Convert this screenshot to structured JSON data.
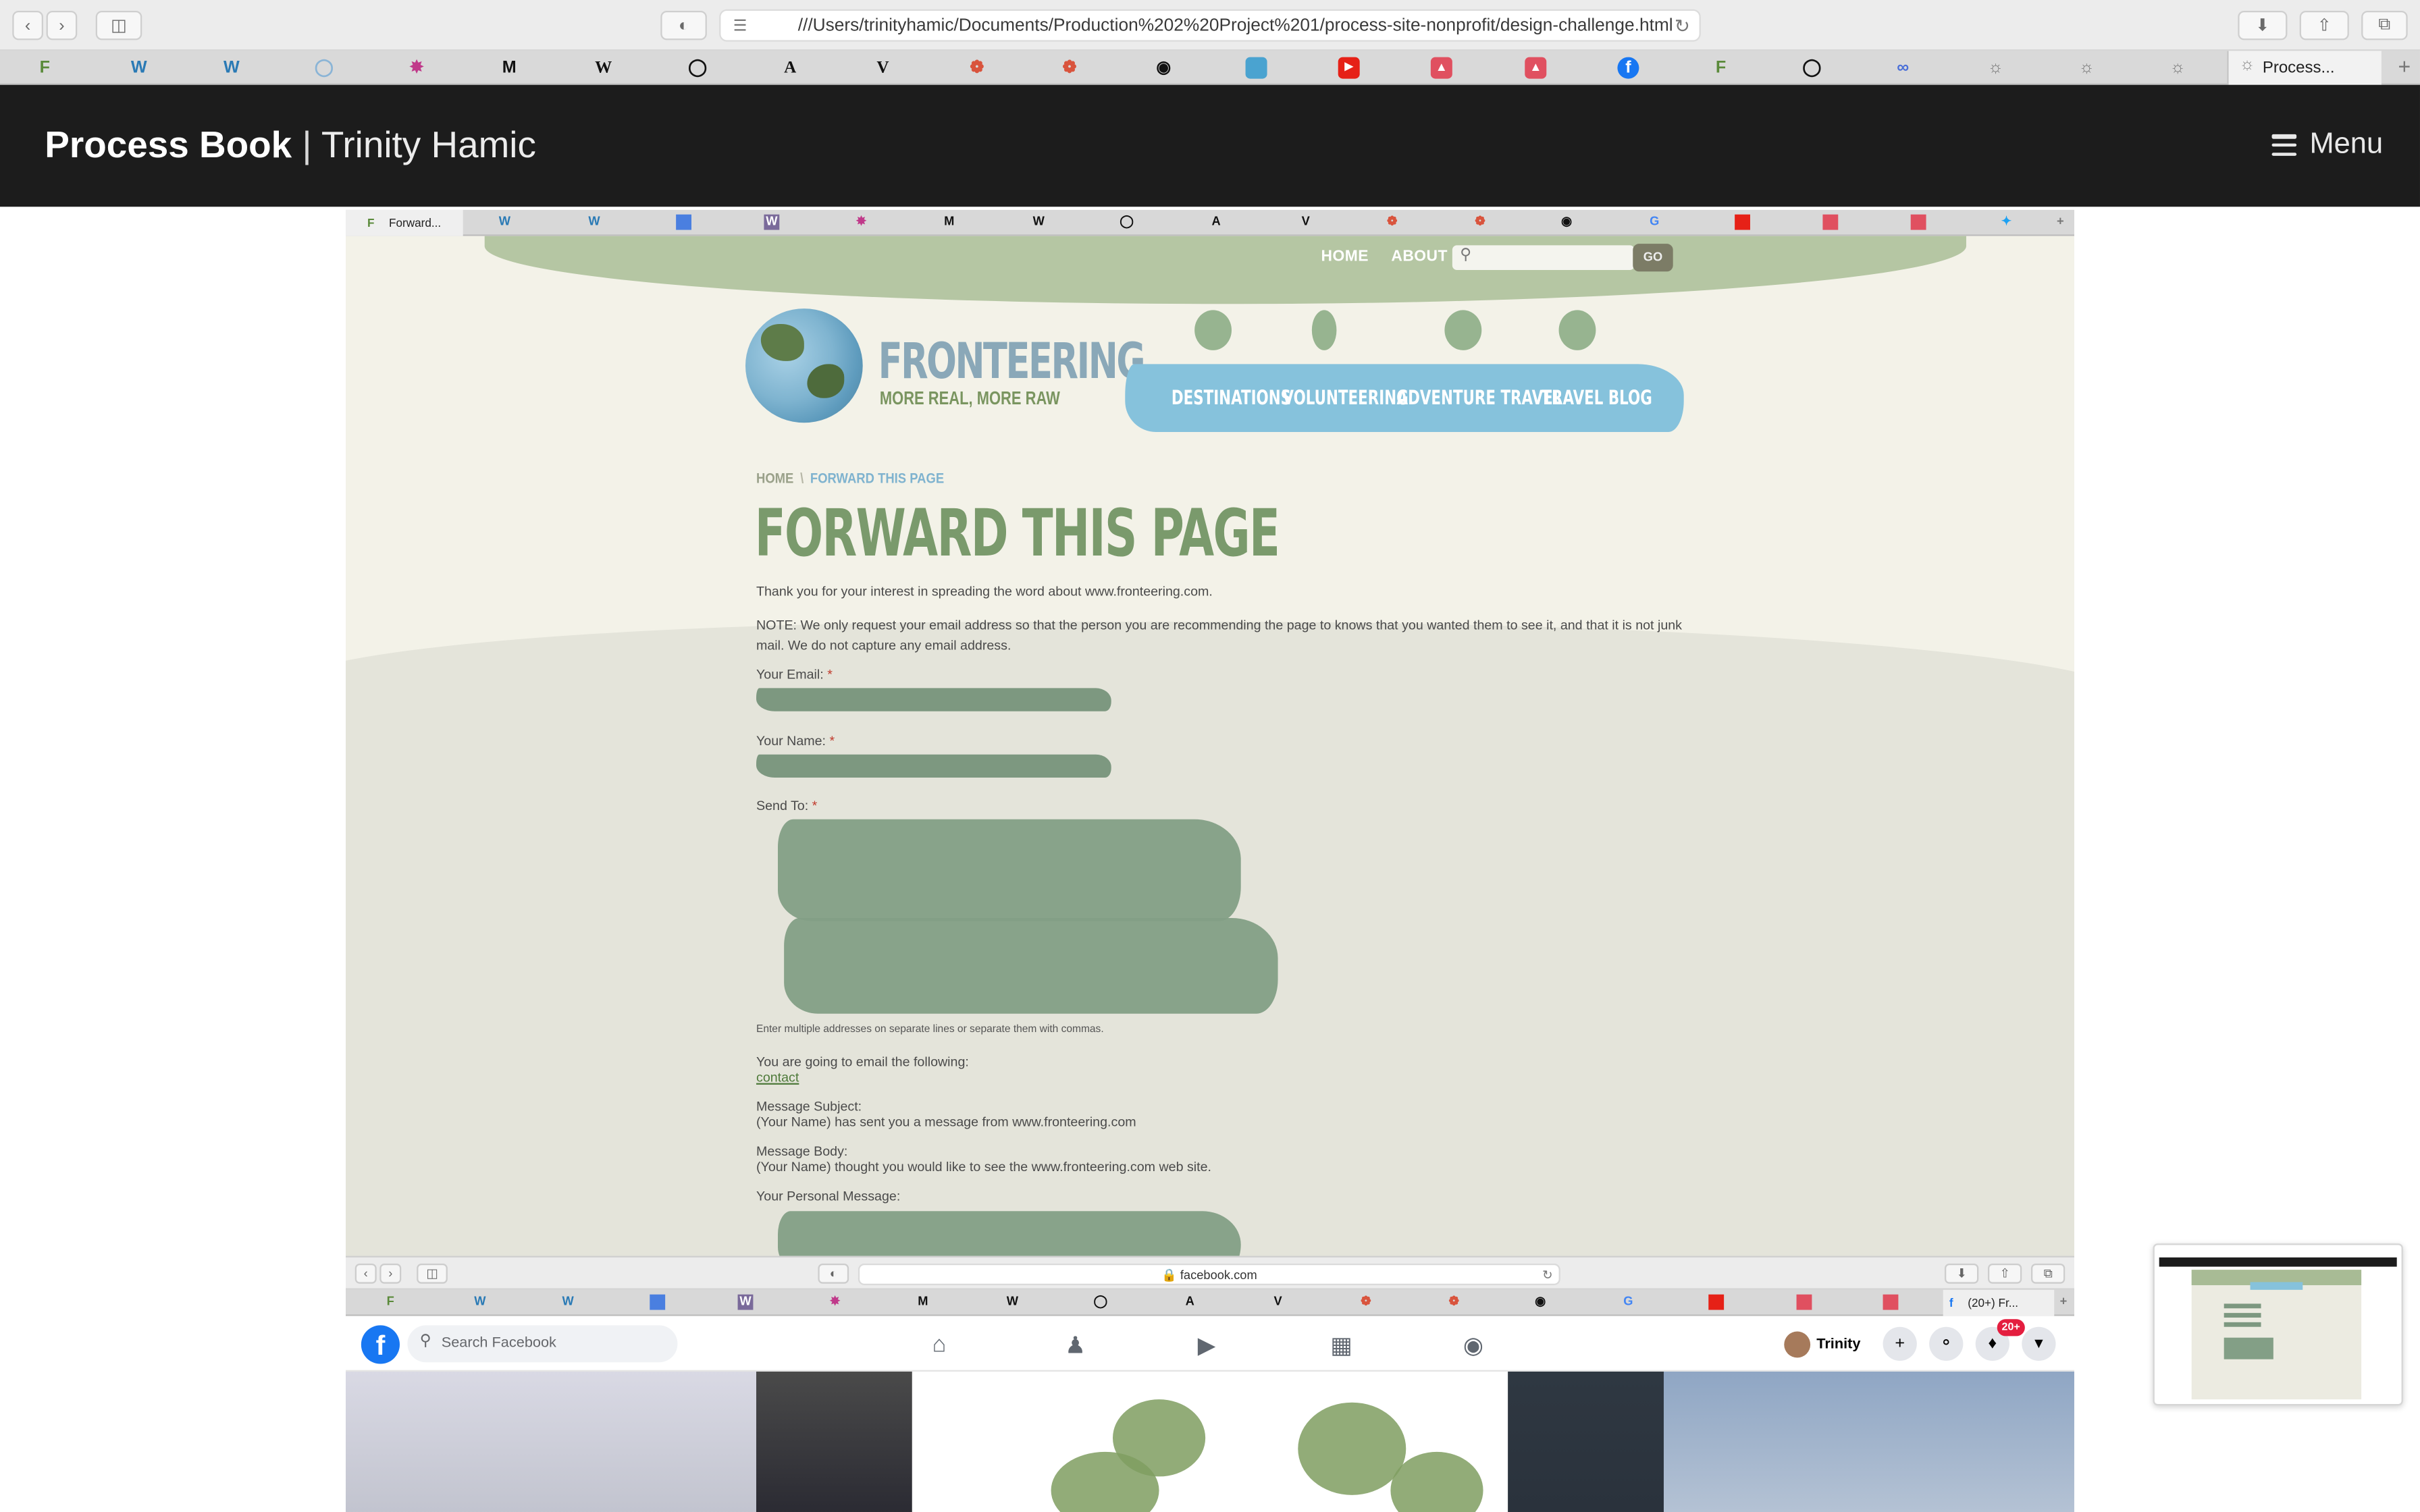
{
  "browser": {
    "url": "///Users/trinityhamic/Documents/Production%202%20Project%201/process-site-nonprofit/design-challenge.html",
    "active_tab": "Process...",
    "favorites": [
      "F",
      "W",
      "W",
      "shield",
      "wheel",
      "Mo",
      "W",
      "instagram",
      "A",
      "V",
      "dot",
      "dot",
      "github",
      "square",
      "youtube",
      "flag",
      "flag",
      "facebook",
      "F",
      "instagram",
      "link",
      "compass",
      "compass",
      "compass"
    ]
  },
  "site_header": {
    "brand_bold": "Process Book",
    "separator": "|",
    "brand_name": "Trinity Hamic",
    "menu_label": "Menu"
  },
  "inner_screenshot": {
    "active_tab": "Forward...",
    "topnav": {
      "home": "HOME",
      "about": "ABOUT US",
      "go": "GO"
    },
    "logo": {
      "word": "FRONTEERING",
      "tagline": "MORE REAL, MORE RAW"
    },
    "mainnav": [
      "DESTINATIONS",
      "VOLUNTEERING",
      "ADVENTURE TRAVEL",
      "TRAVEL BLOG"
    ],
    "breadcrumb": {
      "home": "HOME",
      "sep": "\\",
      "current": "FORWARD THIS PAGE"
    },
    "title": "FORWARD THIS PAGE",
    "intro": "Thank you for your interest in spreading the word about www.fronteering.com.",
    "note": "NOTE: We only request your email address so that the person you are recommending the page to knows that you wanted them to see it, and that it is not junk mail. We do not capture any email address.",
    "fields": {
      "email_label": "Your Email:",
      "name_label": "Your Name:",
      "send_to_label": "Send To:",
      "required": "*",
      "send_to_help": "Enter multiple addresses on separate lines or separate them with commas."
    },
    "summary": {
      "going_label": "You are going to email the following:",
      "link_text": "contact",
      "subject_label": "Message Subject:",
      "subject_value": "(Your Name) has sent you a message from www.fronteering.com",
      "body_label": "Message Body:",
      "body_value": "(Your Name) thought you would like to see the www.fronteering.com web site.",
      "personal_label": "Your Personal Message:"
    },
    "bottom_browser": {
      "url": "facebook.com",
      "active_tab": "(20+) Fr..."
    },
    "facebook": {
      "search_placeholder": "Search Facebook",
      "user": "Trinity",
      "notifications": "20+"
    }
  },
  "colors": {
    "header_bg": "#1c1c1c",
    "site_green": "#7a9a6c",
    "nav_blue": "#86c2dc",
    "facebook_blue": "#1877f2"
  }
}
